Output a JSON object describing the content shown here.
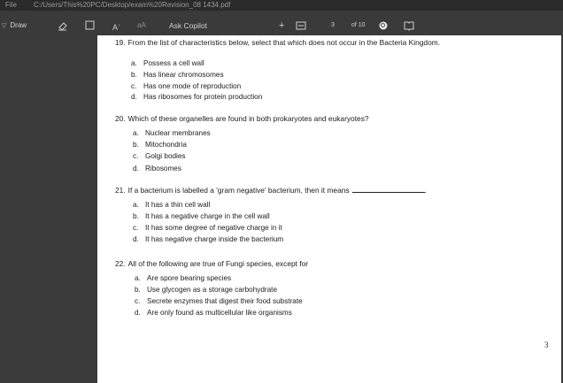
{
  "titlebar": {
    "menu": "File",
    "path": "C:/Users/This%20PC/Desktop/exam%20Revision_08 1434.pdf"
  },
  "toolbar": {
    "draw_label": "Draw",
    "font_a_label": "A",
    "read_aloud_label": "aA",
    "copilot_label": "Ask Copilot",
    "zoom_in_label": "+",
    "page_current": "3",
    "page_of": "of 10"
  },
  "questions": [
    {
      "number": "19.",
      "text": "From the list of characteristics below, select that which does not occur in the Bacteria Kingdom.",
      "options": [
        {
          "letter": "a.",
          "text": "Possess a cell wall"
        },
        {
          "letter": "b.",
          "text": "Has linear chromosomes"
        },
        {
          "letter": "c.",
          "text": "Has one mode of reproduction"
        },
        {
          "letter": "d.",
          "text": "Has ribosomes for protein production"
        }
      ]
    },
    {
      "number": "20.",
      "text": "Which of these organelles are found in both prokaryotes and eukaryotes?",
      "options": [
        {
          "letter": "a.",
          "text": "Nuclear membranes"
        },
        {
          "letter": "b.",
          "text": "Mitochondria"
        },
        {
          "letter": "c.",
          "text": "Golgi bodies"
        },
        {
          "letter": "d.",
          "text": "Ribosomes"
        }
      ]
    },
    {
      "number": "21.",
      "text": "If a bacterium is labelled a 'gram negative' bacterium, then it means",
      "trailing": ".",
      "options": [
        {
          "letter": "a.",
          "text": "It has a thin cell wall"
        },
        {
          "letter": "b.",
          "text": "It has a negative charge in the cell wall"
        },
        {
          "letter": "c.",
          "text": "It has some degree of negative charge in it"
        },
        {
          "letter": "d.",
          "text": "It has negative charge inside the bacterium"
        }
      ]
    },
    {
      "number": "22.",
      "text": "All of the following are true of Fungi species, except for",
      "options": [
        {
          "letter": "a.",
          "text": "Are spore bearing species"
        },
        {
          "letter": "b.",
          "text": "Use glycogen as a storage carbohydrate"
        },
        {
          "letter": "c.",
          "text": "Secrete enzymes that digest their food substrate"
        },
        {
          "letter": "d.",
          "text": "Are only found as multicellular like organisms"
        }
      ]
    }
  ],
  "page_number": "3"
}
